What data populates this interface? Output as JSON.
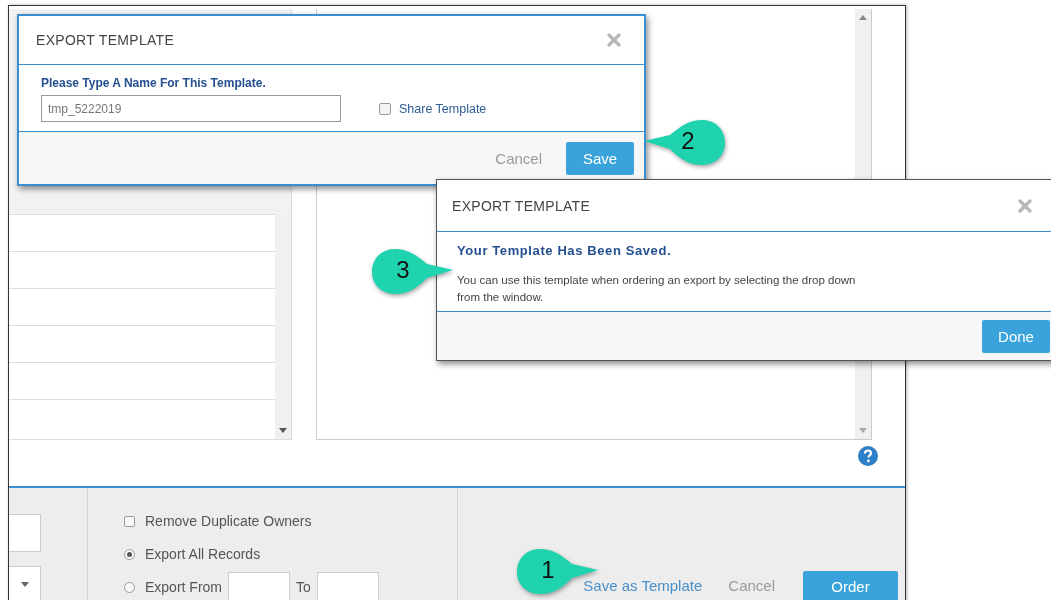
{
  "footer": {
    "options": [
      {
        "kind": "checkbox",
        "label": "Remove Duplicate Owners",
        "checked": false
      },
      {
        "kind": "radio",
        "label": "Export All Records",
        "selected": true
      },
      {
        "kind": "radio-range",
        "label": "Export From",
        "selected": false,
        "to_label": "To"
      }
    ],
    "buttons": [
      {
        "kind": "link",
        "label": "Save as Template"
      },
      {
        "kind": "plain",
        "label": "Cancel"
      },
      {
        "kind": "primary",
        "label": "Order"
      }
    ]
  },
  "dialogs": [
    {
      "title": "EXPORT TEMPLATE",
      "prompt": "Please Type A Name For This Template.",
      "name_value": "tmp_5222019",
      "share": {
        "label": "Share Template",
        "checked": false
      },
      "buttons": [
        {
          "kind": "plain",
          "label": "Cancel"
        },
        {
          "kind": "primary",
          "label": "Save"
        }
      ]
    },
    {
      "title": "EXPORT TEMPLATE",
      "heading": "Your Template Has Been Saved.",
      "message": "You can use this template when ordering an export by selecting the drop down from the window.",
      "buttons": [
        {
          "kind": "primary",
          "label": "Done"
        }
      ]
    }
  ],
  "callouts": [
    "1",
    "2",
    "3"
  ]
}
